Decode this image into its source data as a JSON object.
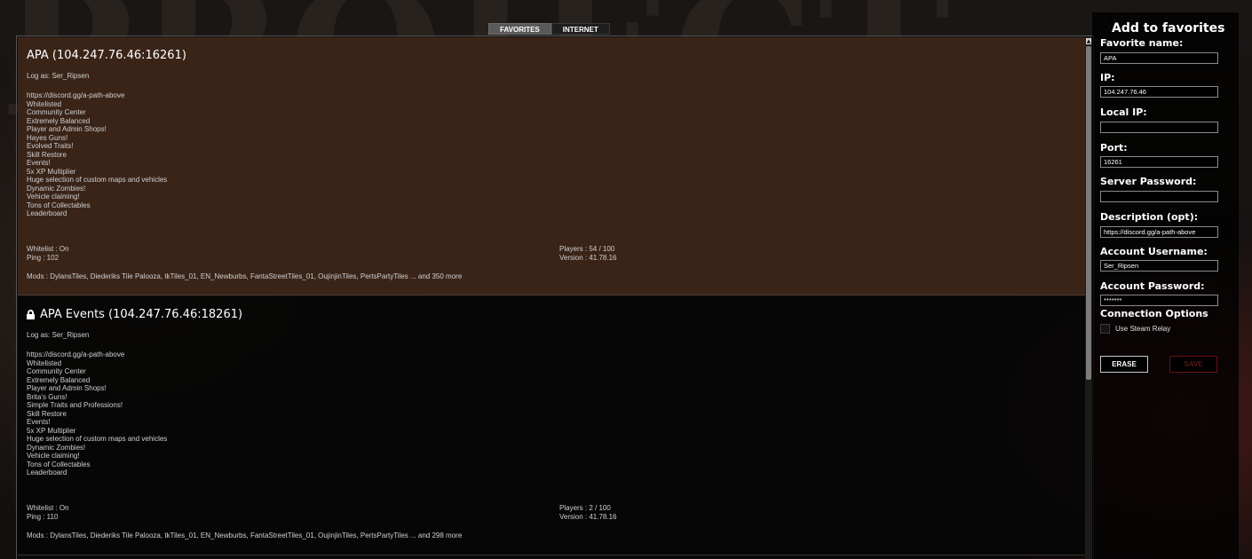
{
  "tabs": [
    {
      "label": "FAVORITES",
      "active": true
    },
    {
      "label": "INTERNET",
      "active": false
    }
  ],
  "servers": [
    {
      "title": "APA (104.247.76.46:16261)",
      "locked": false,
      "selected": true,
      "login": "Log as: Ser_Ripsen",
      "description": [
        "https://discord.gg/a-path-above",
        "Whitelisted",
        "Community Center",
        "Extremely Balanced",
        "Player and Admin Shops!",
        "Hayes Guns!",
        "Evolved Traits!",
        "Skill Restore",
        "Events!",
        "5x XP Multiplier",
        "Huge selection of custom maps and vehicles",
        "Dynamic Zombies!",
        "Vehicle claiming!",
        "Tons of Collectables",
        "Leaderboard"
      ],
      "whitelist": "Whitelist : On",
      "ping": "Ping : 102",
      "players": "Players : 54 / 100",
      "version": "Version : 41.78.16",
      "mods": "Mods : DylansTiles, Diederiks Tile Palooza, tkTiles_01, EN_Newburbs, FantaStreetTiles_01, OujinjinTiles, PertsPartyTiles ... and 350 more"
    },
    {
      "title": "APA Events (104.247.76.46:18261)",
      "locked": true,
      "selected": false,
      "login": "Log as: Ser_Ripsen",
      "description": [
        "https://discord.gg/a-path-above",
        "Whitelisted",
        "Community Center",
        "Extremely Balanced",
        "Player and Admin Shops!",
        "Brita's Guns!",
        "Simple Traits and Professions!",
        "Skill Restore",
        "Events!",
        "5x XP Multiplier",
        "Huge selection of custom maps and vehicles",
        "Dynamic Zombies!",
        "Vehicle claiming!",
        "Tons of Collectables",
        "Leaderboard"
      ],
      "whitelist": "Whitelist : On",
      "ping": "Ping : 110",
      "players": "Players : 2 / 100",
      "version": "Version : 41.78.16",
      "mods": "Mods : DylansTiles, Diederiks Tile Palooza, tkTiles_01, EN_Newburbs, FantaStreetTiles_01, OujinjinTiles, PertsPartyTiles ... and 298 more"
    }
  ],
  "panel": {
    "title": "Add to favorites",
    "fields": {
      "favorite_name": {
        "label": "Favorite name:",
        "value": "APA"
      },
      "ip": {
        "label": "IP:",
        "value": "104.247.76.46"
      },
      "local_ip": {
        "label": "Local IP:",
        "value": ""
      },
      "port": {
        "label": "Port:",
        "value": "16261"
      },
      "server_password": {
        "label": "Server Password:",
        "value": ""
      },
      "description": {
        "label": "Description (opt):",
        "value": "https://discord.gg/a-path-above"
      },
      "account_username": {
        "label": "Account Username:",
        "value": "Ser_Ripsen"
      },
      "account_password": {
        "label": "Account Password:",
        "value": "*******"
      }
    },
    "connection_options_label": "Connection Options",
    "use_steam_relay_label": "Use Steam Relay",
    "use_steam_relay_checked": false,
    "erase_label": "ERASE",
    "save_label": "SAVE"
  },
  "colors": {
    "selected_row": "#3a2418",
    "accent_save_border": "#6b1010"
  }
}
